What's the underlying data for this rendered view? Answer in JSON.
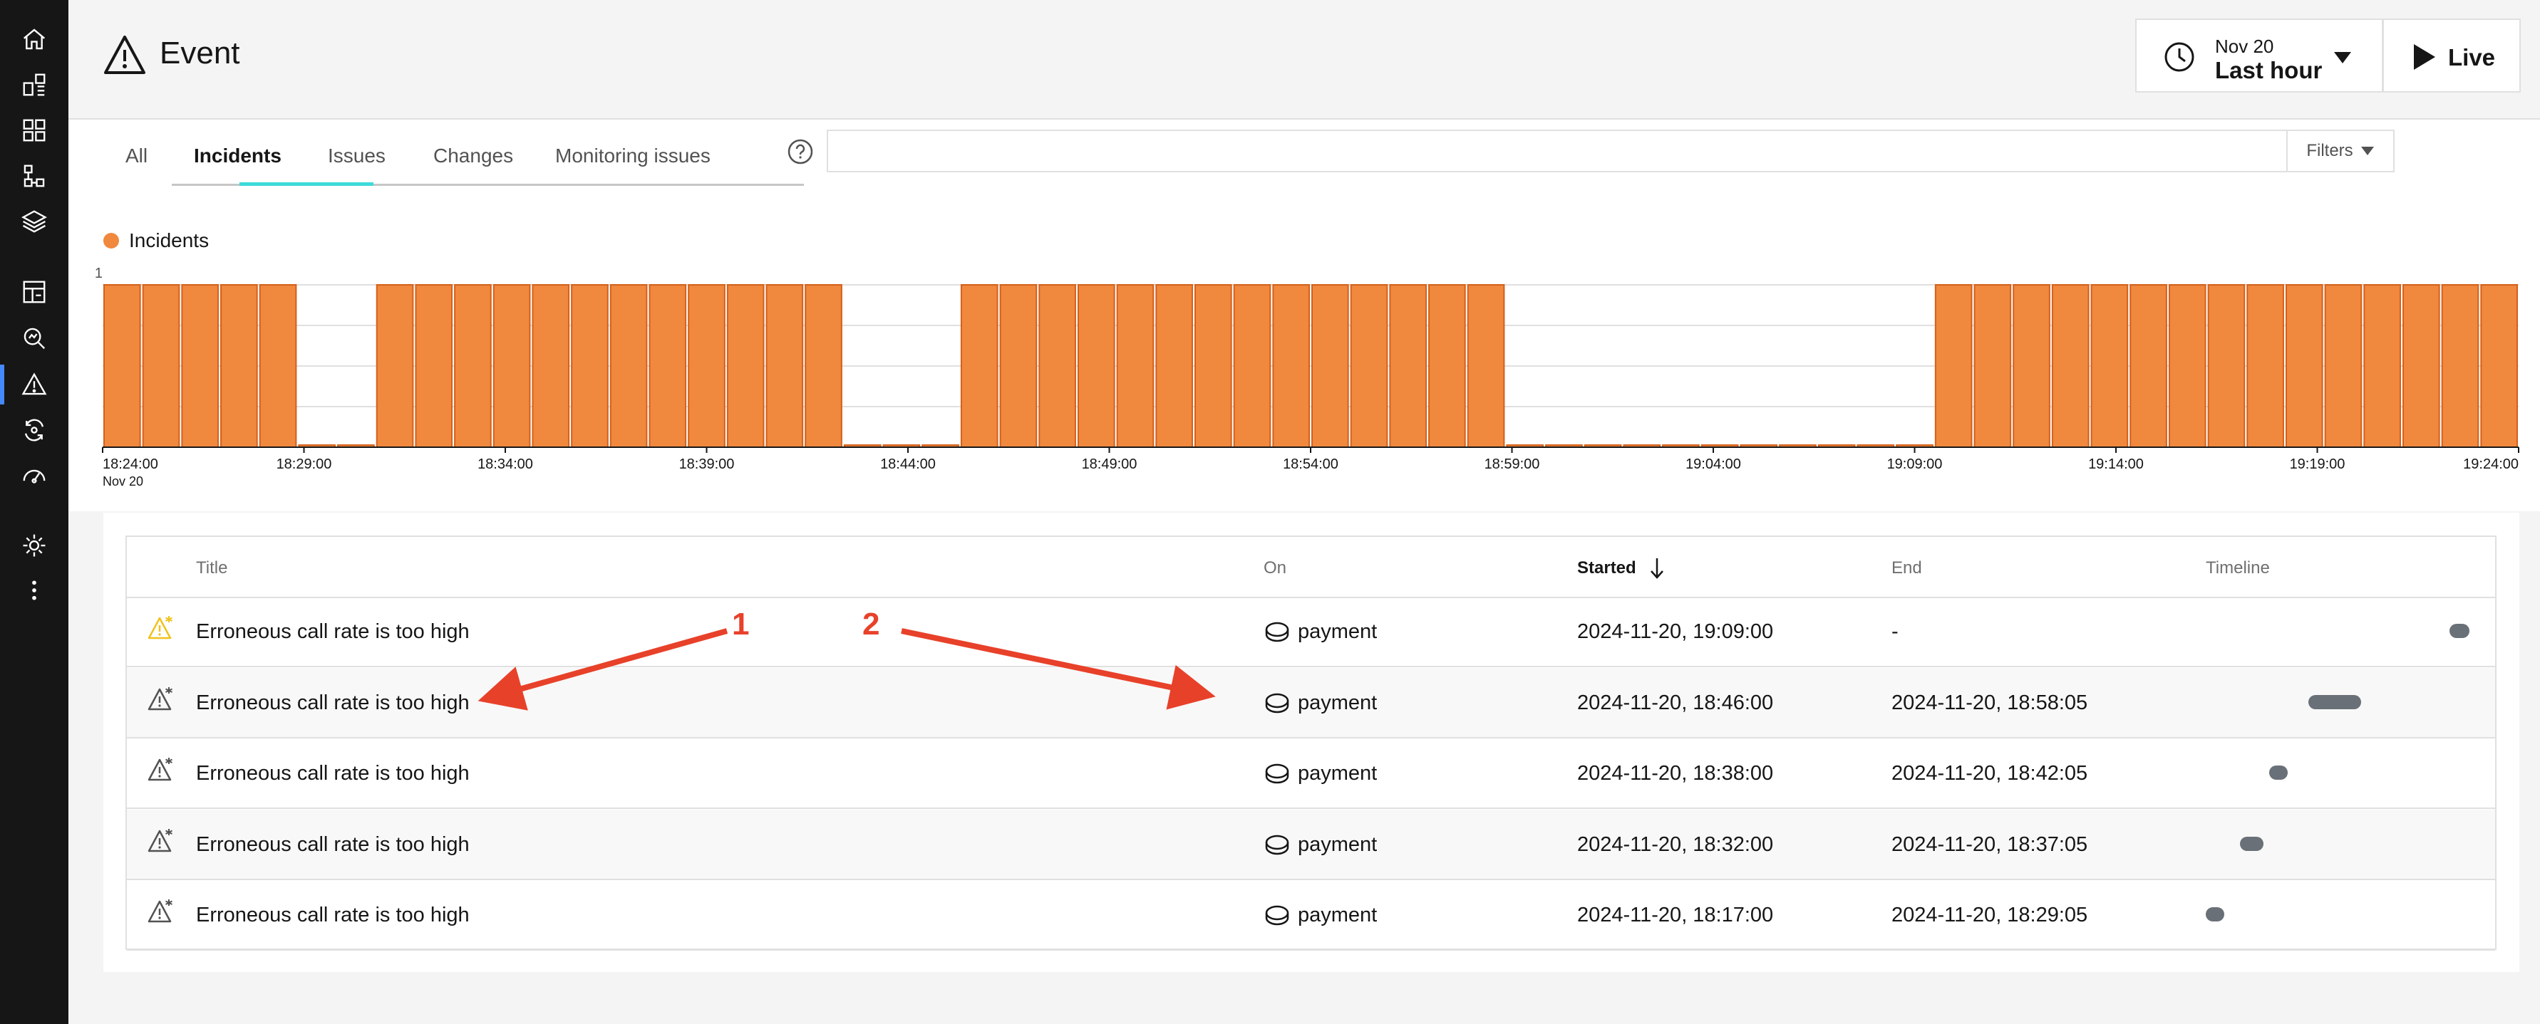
{
  "header": {
    "title": "Event",
    "date": "Nov 20",
    "range": "Last hour",
    "live_label": "Live"
  },
  "tabs": [
    "All",
    "Incidents",
    "Issues",
    "Changes",
    "Monitoring issues"
  ],
  "active_tab": "Incidents",
  "filters_label": "Filters",
  "colors": {
    "incident": "#f0883e",
    "incident_border": "#d4601a",
    "accent": "#3ddbd9",
    "annotation": "#e8412a"
  },
  "chart_data": {
    "type": "bar",
    "series": [
      {
        "name": "Incidents",
        "values": [
          1,
          1,
          1,
          1,
          1,
          0,
          0,
          1,
          1,
          1,
          1,
          1,
          1,
          1,
          1,
          1,
          1,
          1,
          1,
          0,
          0,
          0,
          1,
          1,
          1,
          1,
          1,
          1,
          1,
          1,
          1,
          1,
          1,
          1,
          1,
          1,
          0,
          0,
          0,
          0,
          0,
          0,
          0,
          0,
          0,
          0,
          0,
          1,
          1,
          1,
          1,
          1,
          1,
          1,
          1,
          1,
          1,
          1,
          1,
          1,
          1,
          1
        ]
      }
    ],
    "y_tick": "1",
    "ylim": [
      0,
      1
    ],
    "x_ticks": [
      "18:24:00",
      "18:29:00",
      "18:34:00",
      "18:39:00",
      "18:44:00",
      "18:49:00",
      "18:54:00",
      "18:59:00",
      "19:04:00",
      "19:09:00",
      "19:14:00",
      "19:19:00",
      "19:24:00"
    ],
    "x_sublabel": "Nov 20",
    "grid": true
  },
  "table": {
    "columns": [
      "Title",
      "On",
      "Started",
      "End",
      "Timeline"
    ],
    "sorted_column": "Started",
    "rows": [
      {
        "title": "Erroneous call rate is too high",
        "on": "payment",
        "started": "2024-11-20, 19:09:00",
        "end": "-",
        "open": true,
        "timeline": [
          0.925,
          1.0
        ]
      },
      {
        "title": "Erroneous call rate is too high",
        "on": "payment",
        "started": "2024-11-20, 18:46:00",
        "end": "2024-11-20, 18:58:05",
        "open": false,
        "timeline": [
          0.39,
          0.59
        ]
      },
      {
        "title": "Erroneous call rate is too high",
        "on": "payment",
        "started": "2024-11-20, 18:38:00",
        "end": "2024-11-20, 18:42:05",
        "open": false,
        "timeline": [
          0.24,
          0.31
        ]
      },
      {
        "title": "Erroneous call rate is too high",
        "on": "payment",
        "started": "2024-11-20, 18:32:00",
        "end": "2024-11-20, 18:37:05",
        "open": false,
        "timeline": [
          0.13,
          0.22
        ]
      },
      {
        "title": "Erroneous call rate is too high",
        "on": "payment",
        "started": "2024-11-20, 18:17:00",
        "end": "2024-11-20, 18:29:05",
        "open": false,
        "timeline": [
          0.0,
          0.07
        ]
      }
    ]
  },
  "annotations": [
    "1",
    "2"
  ]
}
